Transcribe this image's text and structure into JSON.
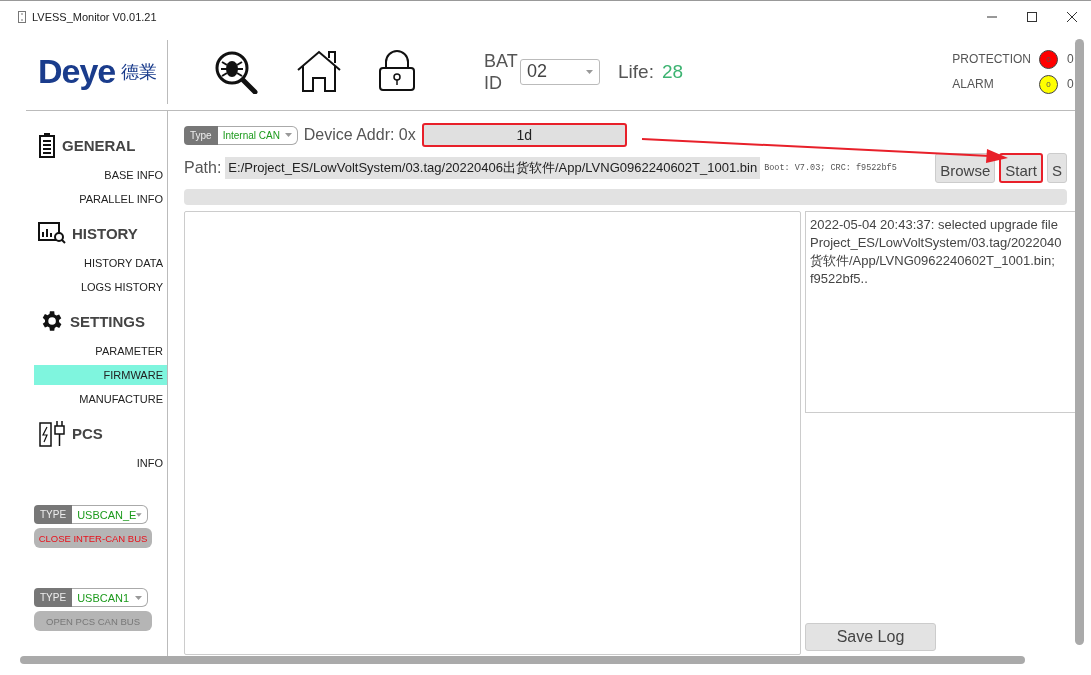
{
  "window": {
    "title": "LVESS_Monitor V0.01.21"
  },
  "header": {
    "logo_text": "Deye",
    "logo_cjk": "德業",
    "bat_label": "BAT ID",
    "bat_id": "02",
    "life_label": "Life:",
    "life_value": "28",
    "indicators": [
      {
        "label": "PROTECTION",
        "count": "0",
        "value": "0",
        "color": "#ff0000"
      },
      {
        "label": "ALARM",
        "count": "0",
        "value": "0",
        "color": "#ffff00"
      }
    ]
  },
  "sidebar": {
    "sections": [
      {
        "kind": "battery",
        "title": "GENERAL",
        "items": [
          {
            "label": "BASE INFO",
            "selected": false
          },
          {
            "label": "PARALLEL INFO",
            "selected": false
          }
        ]
      },
      {
        "kind": "chart",
        "title": "HISTORY",
        "items": [
          {
            "label": "HISTORY DATA",
            "selected": false
          },
          {
            "label": "LOGS HISTORY",
            "selected": false
          }
        ]
      },
      {
        "kind": "gear",
        "title": "SETTINGS",
        "items": [
          {
            "label": "PARAMETER",
            "selected": false
          },
          {
            "label": "FIRMWARE",
            "selected": true
          },
          {
            "label": "MANUFACTURE",
            "selected": false
          }
        ]
      },
      {
        "kind": "plug",
        "title": "PCS",
        "items": [
          {
            "label": "INFO",
            "selected": false
          }
        ]
      }
    ],
    "buses": [
      {
        "type_label": "TYPE",
        "type_value": "USBCAN_E",
        "button": "CLOSE INTER-CAN BUS",
        "active": true
      },
      {
        "type_label": "TYPE",
        "type_value": "USBCAN1",
        "button": "OPEN PCS CAN BUS",
        "active": false
      }
    ]
  },
  "firmware": {
    "type_label": "Type",
    "type_value": "Internal CAN",
    "addr_label": "Device Addr: 0x",
    "addr_value": "1d",
    "addr_highlighted": true,
    "path_label": "Path:",
    "path_value": "E:/Project_ES/LowVoltSystem/03.tag/20220406出货软件/App/LVNG0962240602T_1001.bin",
    "info": "Boot: V7.03; CRC: f9522bf5",
    "buttons": [
      {
        "label": "Browse",
        "highlighted": false
      },
      {
        "label": "Start",
        "highlighted": true
      },
      {
        "label": "S",
        "highlighted": false
      }
    ],
    "progress": {
      "level": 0
    },
    "log": [
      "2022-05-04 20:43:37: selected upgrade file",
      "Project_ES/LowVoltSystem/03.tag/2022040",
      "货软件/App/LVNG0962240602T_1001.bin;",
      "f9522bf5.."
    ],
    "save_log": "Save Log"
  },
  "annotation": {
    "arrow": true
  }
}
